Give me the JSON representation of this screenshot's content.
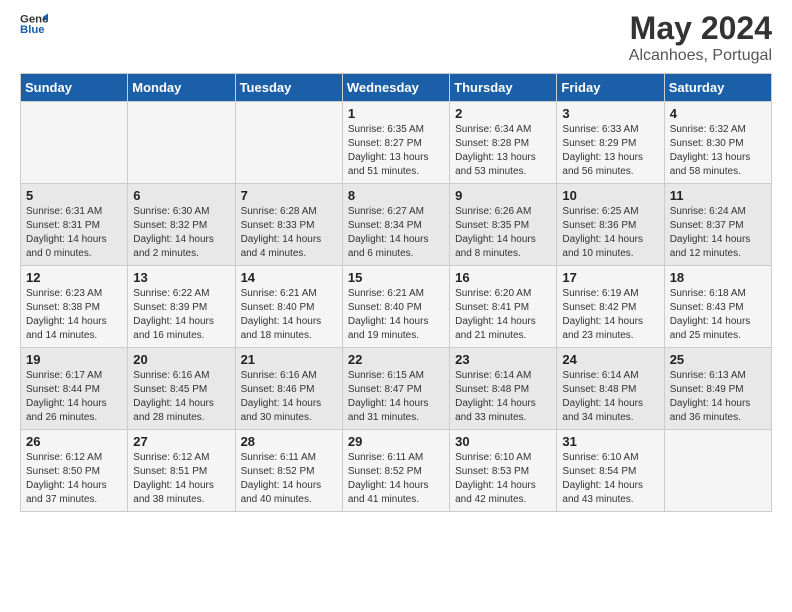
{
  "header": {
    "logo_line1": "General",
    "logo_line2": "Blue",
    "title": "May 2024",
    "subtitle": "Alcanhoes, Portugal"
  },
  "weekdays": [
    "Sunday",
    "Monday",
    "Tuesday",
    "Wednesday",
    "Thursday",
    "Friday",
    "Saturday"
  ],
  "weeks": [
    [
      {
        "day": "",
        "info": ""
      },
      {
        "day": "",
        "info": ""
      },
      {
        "day": "",
        "info": ""
      },
      {
        "day": "1",
        "info": "Sunrise: 6:35 AM\nSunset: 8:27 PM\nDaylight: 13 hours\nand 51 minutes."
      },
      {
        "day": "2",
        "info": "Sunrise: 6:34 AM\nSunset: 8:28 PM\nDaylight: 13 hours\nand 53 minutes."
      },
      {
        "day": "3",
        "info": "Sunrise: 6:33 AM\nSunset: 8:29 PM\nDaylight: 13 hours\nand 56 minutes."
      },
      {
        "day": "4",
        "info": "Sunrise: 6:32 AM\nSunset: 8:30 PM\nDaylight: 13 hours\nand 58 minutes."
      }
    ],
    [
      {
        "day": "5",
        "info": "Sunrise: 6:31 AM\nSunset: 8:31 PM\nDaylight: 14 hours\nand 0 minutes."
      },
      {
        "day": "6",
        "info": "Sunrise: 6:30 AM\nSunset: 8:32 PM\nDaylight: 14 hours\nand 2 minutes."
      },
      {
        "day": "7",
        "info": "Sunrise: 6:28 AM\nSunset: 8:33 PM\nDaylight: 14 hours\nand 4 minutes."
      },
      {
        "day": "8",
        "info": "Sunrise: 6:27 AM\nSunset: 8:34 PM\nDaylight: 14 hours\nand 6 minutes."
      },
      {
        "day": "9",
        "info": "Sunrise: 6:26 AM\nSunset: 8:35 PM\nDaylight: 14 hours\nand 8 minutes."
      },
      {
        "day": "10",
        "info": "Sunrise: 6:25 AM\nSunset: 8:36 PM\nDaylight: 14 hours\nand 10 minutes."
      },
      {
        "day": "11",
        "info": "Sunrise: 6:24 AM\nSunset: 8:37 PM\nDaylight: 14 hours\nand 12 minutes."
      }
    ],
    [
      {
        "day": "12",
        "info": "Sunrise: 6:23 AM\nSunset: 8:38 PM\nDaylight: 14 hours\nand 14 minutes."
      },
      {
        "day": "13",
        "info": "Sunrise: 6:22 AM\nSunset: 8:39 PM\nDaylight: 14 hours\nand 16 minutes."
      },
      {
        "day": "14",
        "info": "Sunrise: 6:21 AM\nSunset: 8:40 PM\nDaylight: 14 hours\nand 18 minutes."
      },
      {
        "day": "15",
        "info": "Sunrise: 6:21 AM\nSunset: 8:40 PM\nDaylight: 14 hours\nand 19 minutes."
      },
      {
        "day": "16",
        "info": "Sunrise: 6:20 AM\nSunset: 8:41 PM\nDaylight: 14 hours\nand 21 minutes."
      },
      {
        "day": "17",
        "info": "Sunrise: 6:19 AM\nSunset: 8:42 PM\nDaylight: 14 hours\nand 23 minutes."
      },
      {
        "day": "18",
        "info": "Sunrise: 6:18 AM\nSunset: 8:43 PM\nDaylight: 14 hours\nand 25 minutes."
      }
    ],
    [
      {
        "day": "19",
        "info": "Sunrise: 6:17 AM\nSunset: 8:44 PM\nDaylight: 14 hours\nand 26 minutes."
      },
      {
        "day": "20",
        "info": "Sunrise: 6:16 AM\nSunset: 8:45 PM\nDaylight: 14 hours\nand 28 minutes."
      },
      {
        "day": "21",
        "info": "Sunrise: 6:16 AM\nSunset: 8:46 PM\nDaylight: 14 hours\nand 30 minutes."
      },
      {
        "day": "22",
        "info": "Sunrise: 6:15 AM\nSunset: 8:47 PM\nDaylight: 14 hours\nand 31 minutes."
      },
      {
        "day": "23",
        "info": "Sunrise: 6:14 AM\nSunset: 8:48 PM\nDaylight: 14 hours\nand 33 minutes."
      },
      {
        "day": "24",
        "info": "Sunrise: 6:14 AM\nSunset: 8:48 PM\nDaylight: 14 hours\nand 34 minutes."
      },
      {
        "day": "25",
        "info": "Sunrise: 6:13 AM\nSunset: 8:49 PM\nDaylight: 14 hours\nand 36 minutes."
      }
    ],
    [
      {
        "day": "26",
        "info": "Sunrise: 6:12 AM\nSunset: 8:50 PM\nDaylight: 14 hours\nand 37 minutes."
      },
      {
        "day": "27",
        "info": "Sunrise: 6:12 AM\nSunset: 8:51 PM\nDaylight: 14 hours\nand 38 minutes."
      },
      {
        "day": "28",
        "info": "Sunrise: 6:11 AM\nSunset: 8:52 PM\nDaylight: 14 hours\nand 40 minutes."
      },
      {
        "day": "29",
        "info": "Sunrise: 6:11 AM\nSunset: 8:52 PM\nDaylight: 14 hours\nand 41 minutes."
      },
      {
        "day": "30",
        "info": "Sunrise: 6:10 AM\nSunset: 8:53 PM\nDaylight: 14 hours\nand 42 minutes."
      },
      {
        "day": "31",
        "info": "Sunrise: 6:10 AM\nSunset: 8:54 PM\nDaylight: 14 hours\nand 43 minutes."
      },
      {
        "day": "",
        "info": ""
      }
    ]
  ]
}
